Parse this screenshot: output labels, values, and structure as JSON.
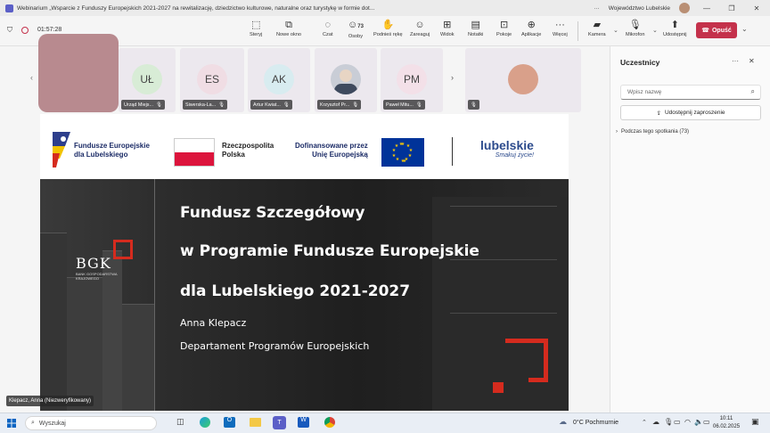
{
  "window": {
    "title": "Webinarium „Wsparcie z Funduszy Europejskich 2021-2027 na rewitalizację, dziedzictwo kulturowe, naturalne oraz turystykę w formie dot...",
    "account": "Województwo Lubelskie",
    "more": "···"
  },
  "meeting": {
    "timer": "01:57:28",
    "toolbar": [
      {
        "label": "Sterуj",
        "icon": "share-screen-icon"
      },
      {
        "label": "Nowe okno",
        "icon": "new-window-icon"
      },
      {
        "label": "Czat",
        "icon": "chat-icon"
      },
      {
        "label": "Osoby",
        "icon": "people-icon",
        "count": "73"
      },
      {
        "label": "Podnieś rękę",
        "icon": "raise-hand-icon"
      },
      {
        "label": "Zareaguj",
        "icon": "react-icon"
      },
      {
        "label": "Widok",
        "icon": "view-icon"
      },
      {
        "label": "Notatki",
        "icon": "notes-icon"
      },
      {
        "label": "Pokoje",
        "icon": "rooms-icon"
      },
      {
        "label": "Aplikacje",
        "icon": "apps-icon"
      },
      {
        "label": "Więcej",
        "icon": "more-icon"
      },
      {
        "label": "Kamera",
        "icon": "camera-off-icon"
      },
      {
        "label": "Mikrofon",
        "icon": "mic-off-icon"
      },
      {
        "label": "Udostępnij",
        "icon": "share-icon"
      }
    ],
    "leave_label": "Opuść"
  },
  "participants": [
    {
      "initials": "",
      "name": "",
      "color": "#b88a8f"
    },
    {
      "initials": "UŁ",
      "name": "Urząd Miejs...",
      "color": "#d8ecd6"
    },
    {
      "initials": "ES",
      "name": "Siwerska-La...",
      "color": "#f0dde4"
    },
    {
      "initials": "AK",
      "name": "Artur Kwiat...",
      "color": "#d8ecf0"
    },
    {
      "initials": "",
      "name": "Krzysztof Pr...",
      "color": "#c9cdd6"
    },
    {
      "initials": "PM",
      "name": "Paweł Mitu...",
      "color": "#f3e0e8"
    },
    {
      "initials": "",
      "name": "",
      "color": "#d9a08a"
    }
  ],
  "slide": {
    "logos": {
      "fe_line1": "Fundusze Europejskie",
      "fe_line2": "dla Lubelskiego",
      "rp_line1": "Rzeczpospolita",
      "rp_line2": "Polska",
      "eu_line1": "Dofinansowane przez",
      "eu_line2": "Unię Europejską",
      "lub_name": "lubelskie",
      "lub_tagline": "Smakuj życie!"
    },
    "bgk": "BGK",
    "bgk_sub1": "BANK GOSPODARSTWA",
    "bgk_sub2": "KRAJOWEGO",
    "title1": "Fundusz Szczegółowy",
    "title2": "w Programie Fundusze Europejskie",
    "title3": "dla Lubelskiego 2021-2027",
    "author": "Anna Klepacz",
    "department": "Departament Programów Europejskich",
    "presenter_label": "Klepacz, Anna (Niezweryfikowany)"
  },
  "panel": {
    "title": "Uczestnicy",
    "search_placeholder": "Wpisz nazwę",
    "share_invite": "Udostępnij zaproszenie",
    "section": "Podczas tego spotkania (73)"
  },
  "taskbar": {
    "search": "Wyszukaj",
    "weather": "0°C  Pochmurnie",
    "time": "10:11",
    "date": "06.02.2025"
  }
}
